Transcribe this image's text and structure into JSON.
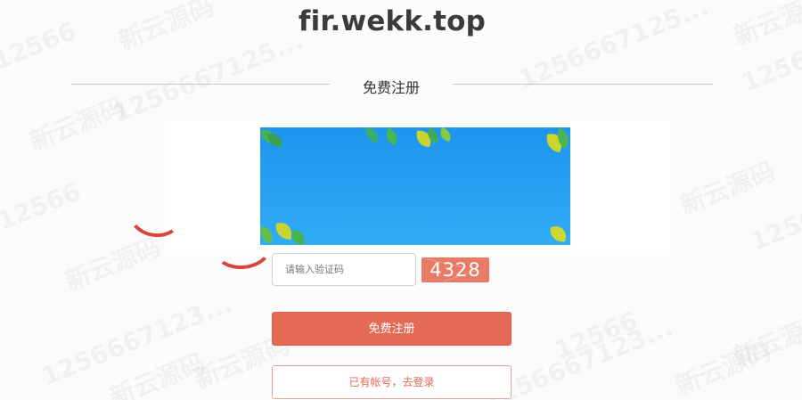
{
  "header": {
    "site_title": "fir.wekk.top"
  },
  "form": {
    "section_title": "免费注册",
    "captcha_placeholder": "请输入验证码",
    "captcha_value": "4328",
    "register_label": "免费注册",
    "login_label": "已有帐号，去登录"
  },
  "watermark": {
    "items": [
      "1256667125...",
      "12566",
      "新云源码",
      "新云源码",
      "12566",
      "新云源码",
      "1256667123...",
      "新云源码",
      "新云源码",
      "12566",
      "新云源码",
      "12566",
      "1256667125...",
      "新云源码",
      "12566",
      "新云源码",
      "1256667123...",
      "新云源码"
    ]
  },
  "colors": {
    "accent": "#e46a55",
    "banner": "#1e95ee",
    "title": "#3b3b3b"
  }
}
